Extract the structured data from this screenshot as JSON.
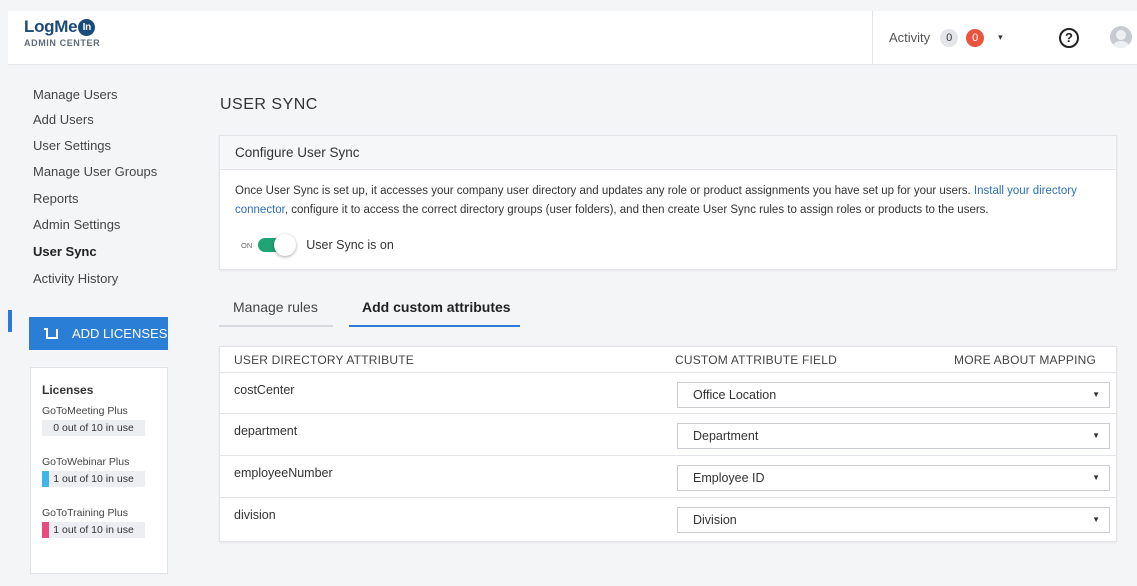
{
  "header": {
    "logo_main": "LogMe",
    "logo_in": "In",
    "logo_sub": "ADMIN CENTER",
    "activity_label": "Activity",
    "activity_count": "0",
    "alert_count": "0",
    "caret": "▾",
    "help": "?"
  },
  "sidebar": {
    "items": [
      {
        "label": "Manage Users"
      },
      {
        "label": "Add Users"
      },
      {
        "label": "User Settings"
      },
      {
        "label": "Manage User Groups"
      },
      {
        "label": "Reports"
      },
      {
        "label": "Admin Settings"
      },
      {
        "label": "User Sync"
      },
      {
        "label": "Activity History"
      }
    ],
    "add_licenses_label": "ADD LICENSES",
    "licenses": {
      "title": "Licenses",
      "items": [
        {
          "name": "GoToMeeting Plus",
          "usage": "0 out of 10 in use",
          "fraction": 0.0,
          "color": "#3fb5e8"
        },
        {
          "name": "GoToWebinar Plus",
          "usage": "1 out of 10 in use",
          "fraction": 0.1,
          "color": "#3fb5e8"
        },
        {
          "name": "GoToTraining Plus",
          "usage": "1 out of 10 in use",
          "fraction": 0.1,
          "color": "#e94b7f"
        }
      ]
    }
  },
  "main": {
    "page_title": "USER SYNC",
    "card": {
      "title": "Configure User Sync",
      "text_1": "Once User Sync is set up, it accesses your company user directory and updates any role or product assignments you have set up for your users. ",
      "link": "Install your directory connector",
      "text_2": ", configure it to access the correct directory groups (user folders), and then create User Sync rules to assign roles or products to the users.",
      "toggle_on_label": "ON",
      "toggle_text": "User Sync is on"
    },
    "tabs": [
      {
        "label": "Manage rules"
      },
      {
        "label": "Add custom attributes"
      }
    ],
    "table": {
      "col_attr": "USER DIRECTORY ATTRIBUTE",
      "col_field": "CUSTOM ATTRIBUTE FIELD",
      "col_more": "MORE ABOUT MAPPING",
      "rows": [
        {
          "attribute": "costCenter",
          "field": "Office Location"
        },
        {
          "attribute": "department",
          "field": "Department"
        },
        {
          "attribute": "employeeNumber",
          "field": "Employee ID"
        },
        {
          "attribute": "division",
          "field": "Division"
        }
      ],
      "caret": "▼"
    }
  }
}
